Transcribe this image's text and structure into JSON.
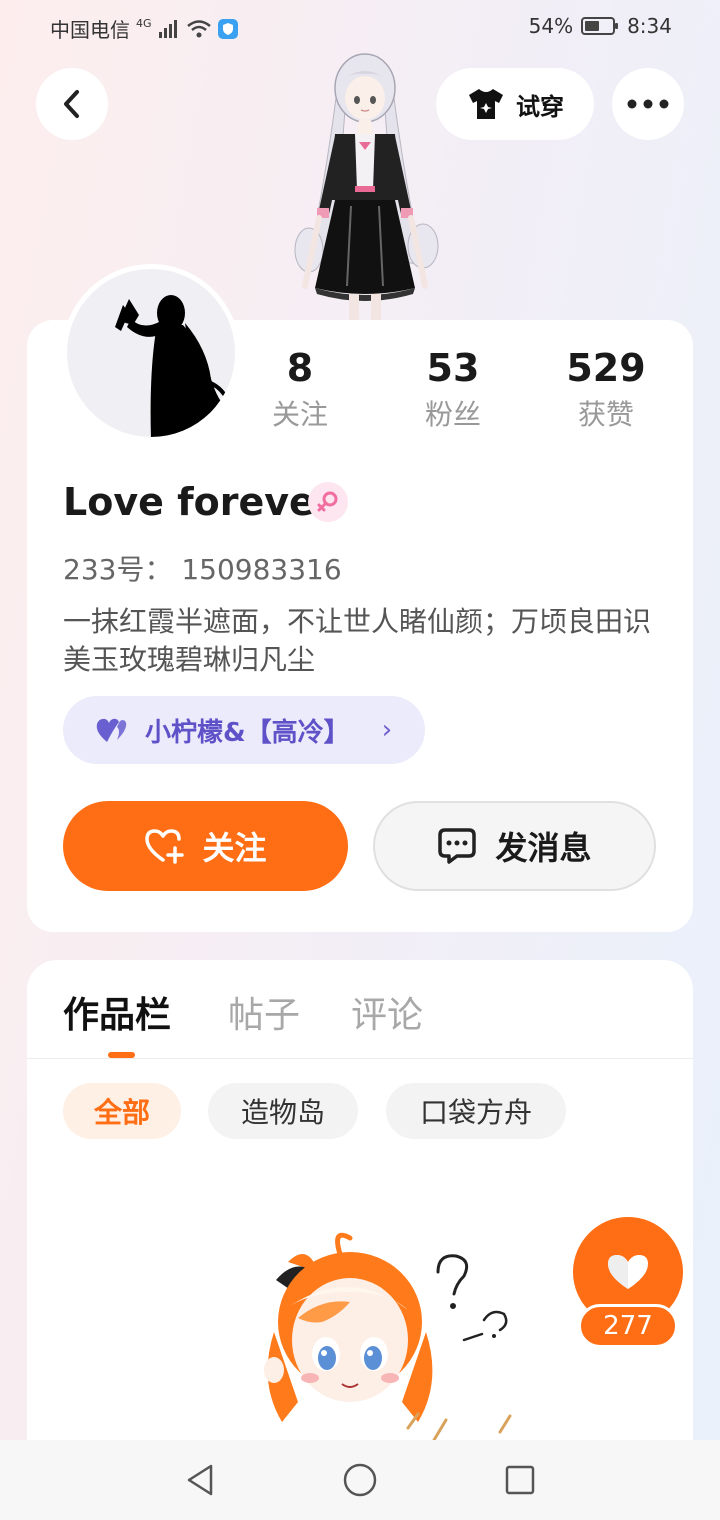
{
  "status_bar": {
    "carrier": "中国电信",
    "network": "4G",
    "battery_percent": "54%",
    "battery_level": 0.54,
    "time": "8:34"
  },
  "header": {
    "back_icon": "chevron-left-icon",
    "try_on_label": "试穿",
    "try_on_icon": "shirt-icon",
    "more_icon": "more-dots-icon"
  },
  "profile": {
    "stats": [
      {
        "value": "8",
        "label": "关注"
      },
      {
        "value": "53",
        "label": "粉丝"
      },
      {
        "value": "529",
        "label": "获赞"
      }
    ],
    "name": "Love forever",
    "gender_icon": "female-icon",
    "uid_text": "233号： 150983316",
    "bio": "一抹红霞半遮面，不让世人睹仙颜；万顷良田识美玉玫瑰碧琳归凡尘",
    "group_chip": {
      "icon": "hearts-icon",
      "label": "小柠檬&【高冷】",
      "chevron": "›"
    },
    "follow_label": "关注",
    "message_label": "发消息"
  },
  "works": {
    "tabs": [
      {
        "label": "作品栏",
        "active": true
      },
      {
        "label": "帖子",
        "active": false
      },
      {
        "label": "评论",
        "active": false
      }
    ],
    "filters": [
      {
        "label": "全部",
        "active": true
      },
      {
        "label": "造物岛",
        "active": false
      },
      {
        "label": "口袋方舟",
        "active": false
      }
    ],
    "like_count": "277"
  },
  "colors": {
    "accent": "#ff6e14",
    "chip_bg": "#ecebfb",
    "chip_text": "#5f52c8",
    "gender_pink": "#f06fa0"
  }
}
